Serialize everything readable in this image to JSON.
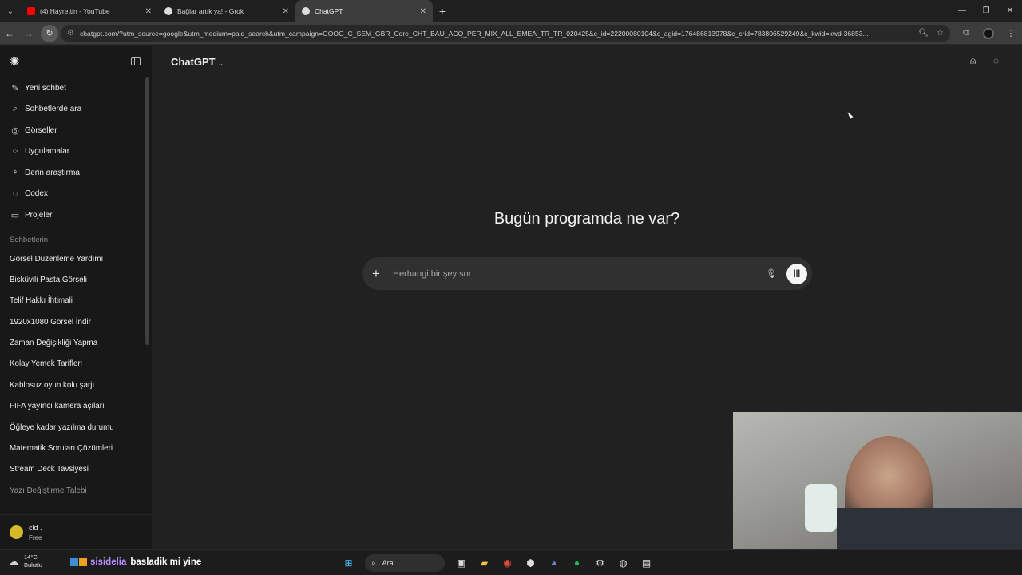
{
  "browser": {
    "tabs": [
      {
        "title": "(4) Hayrettin - YouTube",
        "color": "#ff0000",
        "active": false
      },
      {
        "title": "Bağlar artık ya! - Grok",
        "color": "#dddddd",
        "active": false
      },
      {
        "title": "ChatGPT",
        "color": "#dddddd",
        "active": true
      }
    ],
    "url": "chatgpt.com/?utm_source=google&utm_medium=paid_search&utm_campaign=GOOG_C_SEM_GBR_Core_CHT_BAU_ACQ_PER_MIX_ALL_EMEA_TR_TR_020425&c_id=22200080104&c_agid=176486813978&c_crid=783806529249&c_kwid=kwd-36853..."
  },
  "sidebar": {
    "nav": [
      {
        "label": "Yeni sohbet",
        "icon": "edit-icon"
      },
      {
        "label": "Sohbetlerde ara",
        "icon": "search-icon"
      },
      {
        "label": "Görseller",
        "icon": "images-icon"
      },
      {
        "label": "Uygulamalar",
        "icon": "apps-icon"
      },
      {
        "label": "Derin araştırma",
        "icon": "telescope-icon"
      },
      {
        "label": "Codex",
        "icon": "codex-icon"
      },
      {
        "label": "Projeler",
        "icon": "folder-icon"
      }
    ],
    "section_label": "Sohbetlerin",
    "chats": [
      "Görsel Düzenleme Yardımı",
      "Bisküvili Pasta Görseli",
      "Telif Hakkı İhtimali",
      "1920x1080 Görsel İndir",
      "Zaman Değişikliği Yapma",
      "Kolay Yemek Tarifleri",
      "Kablosuz oyun kolu şarjı",
      "FIFA yayıncı kamera açıları",
      "Öğleye kadar yazılma durumu",
      "Matematik Soruları Çözümleri",
      "Stream Deck Tavsiyesi",
      "Yazı Değiştirme Talebi"
    ],
    "user": {
      "name": "cld .",
      "plan": "Free"
    }
  },
  "main": {
    "model": "ChatGPT",
    "heading": "Bugün programda ne var?",
    "composer_placeholder": "Herhangi bir şey sor"
  },
  "taskbar": {
    "temperature": "14°C",
    "condition": "Bulutlu",
    "overlay_nick": "sisidelia",
    "overlay_message": "basladik mi yine",
    "search_label": "Ara"
  }
}
